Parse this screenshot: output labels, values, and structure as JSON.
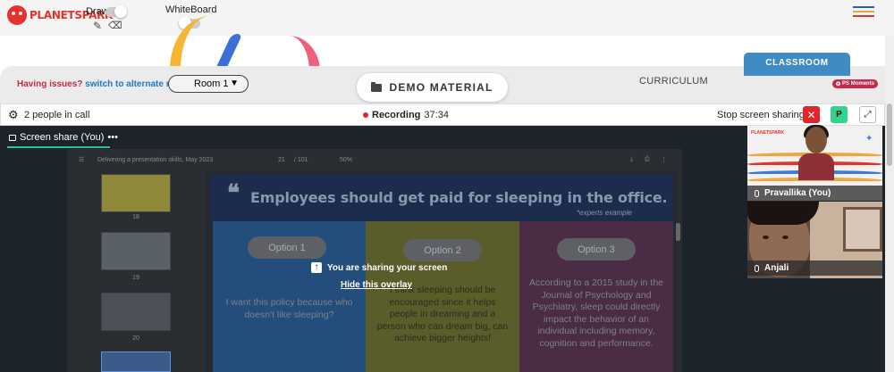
{
  "topbar": {
    "logo_text": "PLANETSPARK",
    "draw_label": "Draw",
    "whiteboard_label": "WhiteBoard"
  },
  "header": {
    "issues_text": "Having issues?",
    "alternate_link": "switch to alternate room",
    "room_value": "Room 1",
    "demo_material_label": "DEMO MATERIAL",
    "curriculum_label": "CURRICULUM",
    "classroom_label": "CLASSROOM",
    "moments_label": "PS Moments"
  },
  "callbar": {
    "people_text": "2 people in call",
    "recording_label": "Recording",
    "recording_time": "37:34",
    "stop_share_label": "Stop screen sharing",
    "p_button_label": "P"
  },
  "screenshare": {
    "tab_label": "Screen share (You)",
    "tab_menu": "•••",
    "viewer_title": "Delivering a presentation skills, May 2023",
    "page_current": "21",
    "page_total": "/ 101",
    "zoom": "50%",
    "thumbnail_numbers": [
      "18",
      "19",
      "20"
    ],
    "slide_title": "Employees should get paid for sleeping in the office.",
    "slide_subtitle": "*experts example",
    "options": [
      {
        "label": "Option 1",
        "text": "I want this policy because who doesn't like sleeping?"
      },
      {
        "label": "Option 2",
        "text": "I think sleeping should be encouraged since it helps people in dreaming and a person who can dream big, can achieve bigger heights!"
      },
      {
        "label": "Option 3",
        "text": "According to a 2015 study in the Journal of Psychology and Psychiatry, sleep could directly impact the behavior of an individual including memory, cognition and performance."
      }
    ],
    "sharing_message": "You are sharing your screen",
    "hide_overlay_link": "Hide this overlay"
  },
  "participants": [
    {
      "name": "Pravallika (You)"
    },
    {
      "name": "Anjali"
    }
  ],
  "colors": {
    "brand_red": "#e5322d",
    "classroom_blue": "#3e8cc3",
    "recording_red": "#e0262b",
    "p_green": "#2fd58a",
    "accent_teal": "#2ac09a"
  }
}
